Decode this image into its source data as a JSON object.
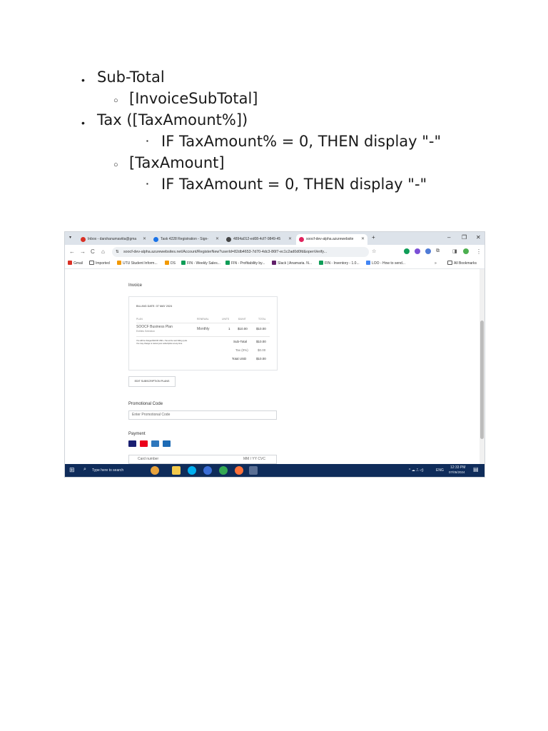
{
  "document": {
    "items": [
      {
        "level": 1,
        "text": "Sub-Total"
      },
      {
        "level": 2,
        "text": "[InvoiceSubTotal]"
      },
      {
        "level": 1,
        "text": "Tax ([TaxAmount%])"
      },
      {
        "level": 3,
        "text": "IF TaxAmount% = 0, THEN display \"-\""
      },
      {
        "level": 2,
        "text": "[TaxAmount]"
      },
      {
        "level": 3,
        "text": "IF TaxAmount = 0, THEN display \"-\""
      }
    ]
  },
  "browser": {
    "tabs": [
      {
        "label": "Inbox - darshanumaviita@gma",
        "icon": "gmail-icon",
        "color": "#d93025"
      },
      {
        "label": "Task 4228 Registration - Sign-",
        "icon": "task-icon",
        "color": "#1a73e8"
      },
      {
        "label": "4894a012-ed08-4cf7-9849-45",
        "icon": "page-icon",
        "color": "#444444"
      },
      {
        "label": "soocf-dev-alpha.azurewebsite",
        "icon": "site-icon",
        "color": "#e0245e"
      }
    ],
    "new_tab": "+",
    "url": "soocf-dev-alpha.azurewebsites.net/Account/RegisterNew?userId=82db4653-7d70-4dc3-86f7-ec1c2ad0d0fd&openVerify...",
    "bookmarks": [
      {
        "label": "Gmail",
        "color": "#d93025"
      },
      {
        "label": "Imported",
        "color": "#555555"
      },
      {
        "label": "UTU Student Inform...",
        "color": "#f29900"
      },
      {
        "label": "DS",
        "color": "#f29900"
      },
      {
        "label": "FIN - Weekly Sales...",
        "color": "#0f9d58"
      },
      {
        "label": "FIN - Profitability by...",
        "color": "#0f9d58"
      },
      {
        "label": "Slack | Anamaria. N...",
        "color": "#611f69"
      },
      {
        "label": "FIN - Inventory - 1.0...",
        "color": "#0f9d58"
      },
      {
        "label": "LOO - How to send...",
        "color": "#4285f4"
      }
    ],
    "bookmarks_more": "»",
    "all_bookmarks": "All Bookmarks"
  },
  "invoice": {
    "heading": "Invoice",
    "billing_date": "BILLING DATE: 07 MAY 2024",
    "columns": [
      "PLAN",
      "RENEWAL",
      "UNITS",
      "$/UNIT",
      "TOTAL"
    ],
    "row": {
      "plan": "SOOCF Business Plan",
      "plan_sub": "Entities Selection",
      "renewal": "Monthly",
      "units": "1",
      "unit_price": "$10.00",
      "total": "$10.00"
    },
    "note_lines": [
      "You will be charged $10.00 USD + Tax at the next billing cycle.",
      "You may change or cancel your subscription at any time."
    ],
    "subtotal_label": "Sub-Total",
    "subtotal_value": "$10.00",
    "tax_label": "Tax (0%)",
    "tax_value": "$0.00",
    "total_label": "Total USD",
    "total_value": "$10.00",
    "edit_button": "EDIT SUBSCRIPTION PLANS",
    "promo_heading": "Promotional Code",
    "promo_placeholder": "Enter Promotional Code",
    "payment_heading": "Payment",
    "card_placeholder": "Card number",
    "expiry_placeholder": "MM / YY  CVC"
  },
  "taskbar": {
    "search_placeholder": "Type here to search",
    "lang": "ENG",
    "time": "12:33 PM",
    "date": "07/05/2024"
  }
}
